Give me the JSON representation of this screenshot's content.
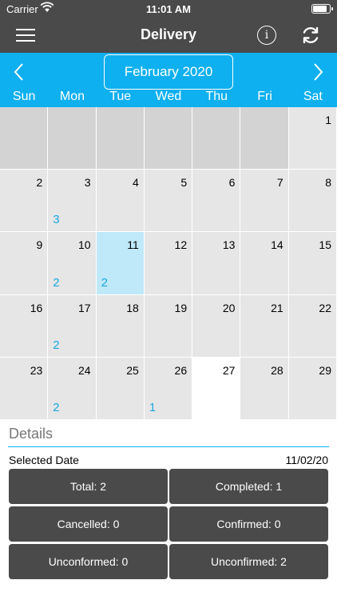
{
  "status_bar": {
    "carrier": "Carrier",
    "time": "11:01 AM",
    "battery_level": 0.85
  },
  "nav": {
    "title": "Delivery",
    "info_glyph": "i"
  },
  "calendar": {
    "month_label": "February 2020",
    "weekdays": [
      "Sun",
      "Mon",
      "Tue",
      "Wed",
      "Thu",
      "Fri",
      "Sat"
    ],
    "first_weekday_index": 6,
    "days_in_month": 29,
    "selected_day": 11,
    "blank_days": [
      27
    ],
    "counts": {
      "3": "3",
      "10": "2",
      "11": "2",
      "17": "2",
      "24": "2",
      "26": "1"
    },
    "colors": {
      "header": "#0fb0ef",
      "count_text": "#1ba8de",
      "selected_cell": "#bfe8f9"
    }
  },
  "details": {
    "title": "Details",
    "selected_date_label": "Selected Date",
    "selected_date_value": "11/02/20",
    "buttons": {
      "total": "Total: 2",
      "completed": "Completed: 1",
      "cancelled": "Cancelled: 0",
      "confirmed": "Confirmed: 0",
      "unconformed": "Unconformed: 0",
      "unconfirmed": "Unconfirmed: 2"
    }
  }
}
